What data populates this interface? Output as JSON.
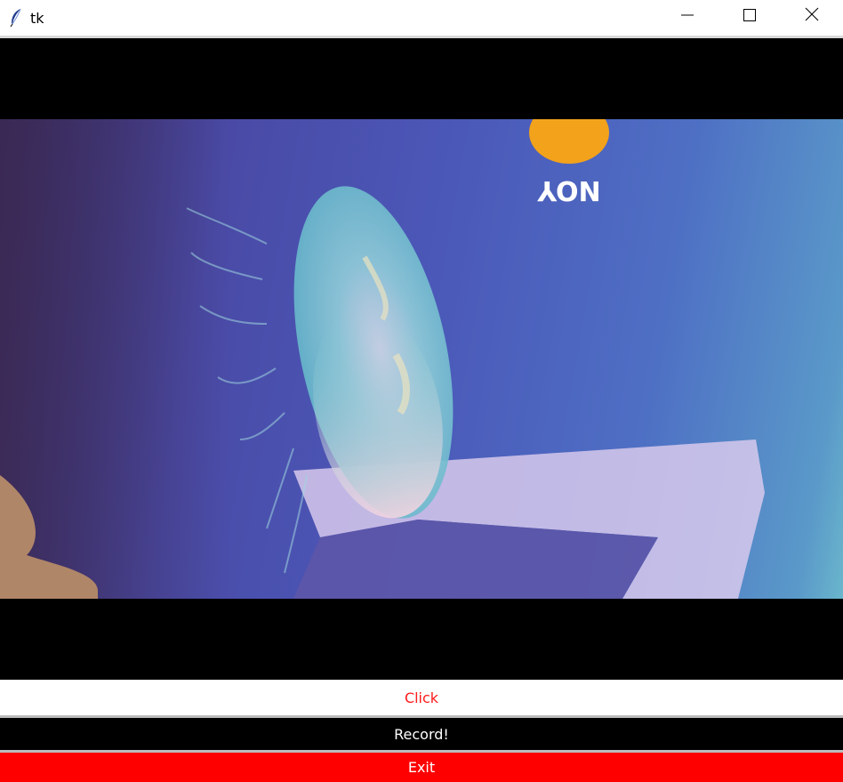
{
  "window": {
    "title": "tk",
    "app_icon": "feather-icon",
    "controls": [
      "minimize-icon",
      "maximize-icon",
      "close-icon"
    ]
  },
  "video": {
    "overlay_text": "NOY"
  },
  "buttons": {
    "click_label": "Click",
    "record_label": "Record!",
    "exit_label": "Exit"
  },
  "colors": {
    "click_text": "#ff1a1a",
    "record_bg": "#000000",
    "exit_bg": "#ff0000"
  }
}
